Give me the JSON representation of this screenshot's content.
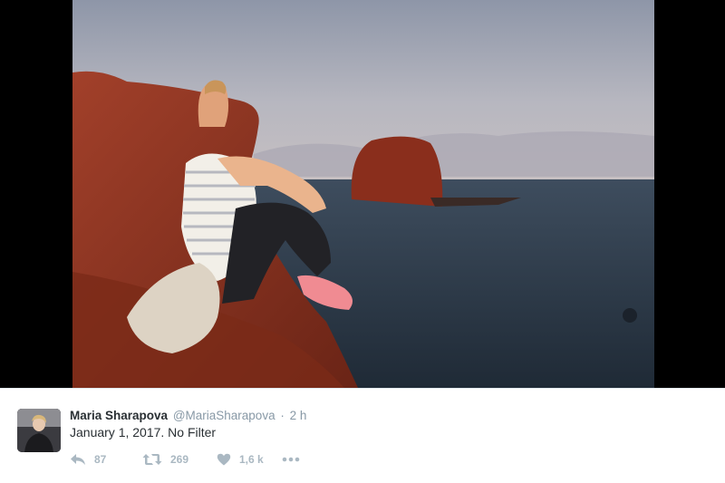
{
  "tweet": {
    "display_name": "Maria Sharapova",
    "handle": "@MariaSharapova",
    "separator": "·",
    "timestamp": "2 h",
    "text": "January 1, 2017. No Filter"
  },
  "actions": {
    "reply_count": "87",
    "retweet_count": "269",
    "like_count": "1,6 k"
  },
  "icons": {
    "reply": "reply-icon",
    "retweet": "retweet-icon",
    "like": "heart-icon",
    "more": "more-icon"
  },
  "colors": {
    "icon_gray": "#aab8c2",
    "name_text": "#292f33",
    "muted_text": "#8899a6"
  }
}
